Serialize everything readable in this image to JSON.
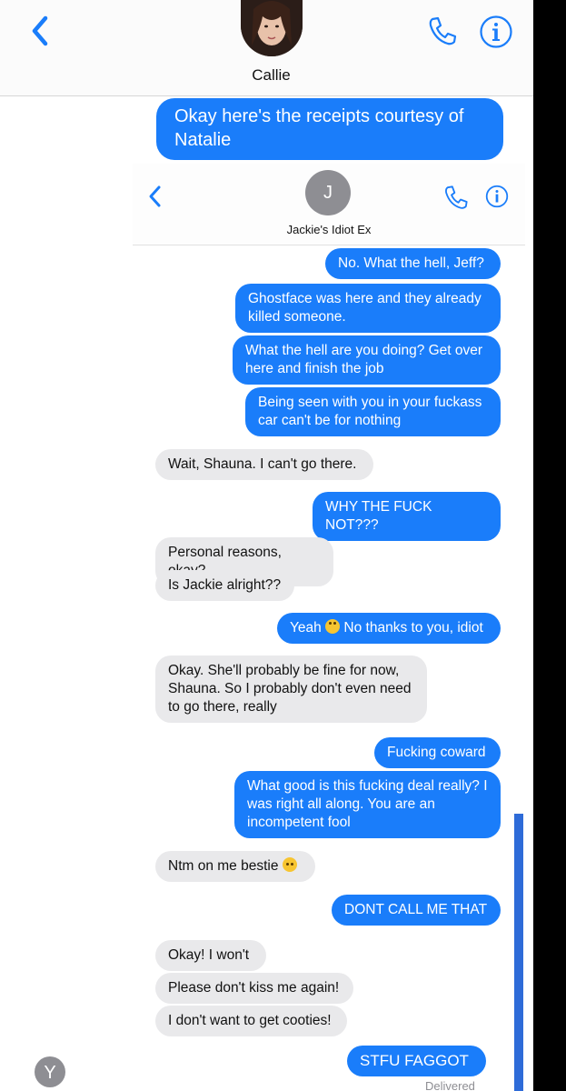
{
  "outer": {
    "contact_name": "Callie",
    "message": "Okay here's the receipts courtesy of Natalie"
  },
  "inner": {
    "contact_initial": "J",
    "contact_name": "Jackie's Idiot Ex",
    "messages": [
      {
        "from": "me",
        "text": "No. What the hell, Jeff?"
      },
      {
        "from": "me",
        "text": "Ghostface was here and they already killed someone."
      },
      {
        "from": "me",
        "text": "What the hell are you doing? Get over here and finish the job"
      },
      {
        "from": "me",
        "text": "Being seen with you in your fuckass car can't be for nothing"
      },
      {
        "from": "them",
        "text": "Wait, Shauna. I can't go there."
      },
      {
        "from": "me",
        "text": "WHY THE FUCK NOT???"
      },
      {
        "from": "them",
        "text": "Personal reasons, okay?"
      },
      {
        "from": "them",
        "text": "Is Jackie alright??"
      },
      {
        "from": "me",
        "text": "Yeah",
        "emoji": "eye-roll-emoji",
        "text2": "No thanks to you, idiot"
      },
      {
        "from": "them",
        "text": "Okay. She'll probably be fine for now, Shauna. So I probably don't even need to go there, really"
      },
      {
        "from": "me",
        "text": "Fucking coward"
      },
      {
        "from": "me",
        "text": "What good is this fucking deal really? I was right all along. You are an incompetent fool"
      },
      {
        "from": "them",
        "text": "Ntm on me bestie",
        "emoji": "crying-emoji"
      },
      {
        "from": "me",
        "text": "DONT CALL ME THAT"
      },
      {
        "from": "them",
        "text": "Okay! I won't"
      },
      {
        "from": "them",
        "text": "Please don't kiss me again!"
      },
      {
        "from": "them",
        "text": "I don't want to get cooties!"
      },
      {
        "from": "me",
        "text": "STFU FAGGOT"
      }
    ],
    "status": "Delivered"
  },
  "bottom_avatar_initial": "Y",
  "colors": {
    "blue": "#1a7dfa",
    "gray": "#e9e9eb",
    "accent": "#1a7dfa"
  }
}
